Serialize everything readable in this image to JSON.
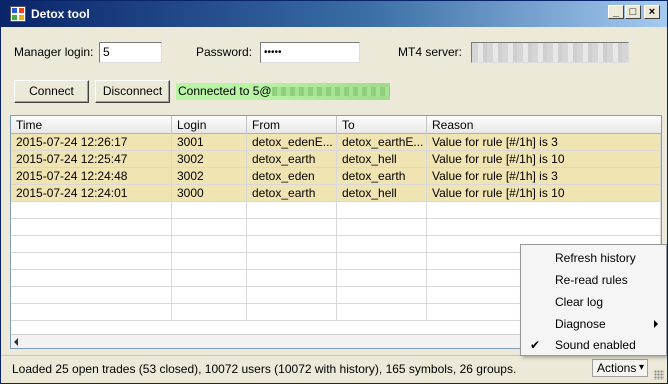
{
  "window": {
    "title": "Detox tool",
    "min_glyph": "_",
    "max_glyph": "□",
    "close_glyph": "×"
  },
  "form": {
    "manager_login_label": "Manager login:",
    "manager_login_value": "5",
    "password_label": "Password:",
    "password_value": "•••••",
    "server_label": "MT4 server:",
    "server_value": ""
  },
  "buttons": {
    "connect": "Connect",
    "disconnect": "Disconnect"
  },
  "connection_status": "Connected to 5@",
  "grid": {
    "columns": [
      "Time",
      "Login",
      "From",
      "To",
      "Reason"
    ],
    "rows": [
      [
        "2015-07-24 12:26:17",
        "3001",
        "detox_edenE...",
        "detox_earthE...",
        "Value for rule [#/1h] is 3"
      ],
      [
        "2015-07-24 12:25:47",
        "3002",
        "detox_earth",
        "detox_hell",
        "Value for rule [#/1h] is 10"
      ],
      [
        "2015-07-24 12:24:48",
        "3002",
        "detox_eden",
        "detox_earth",
        "Value for rule [#/1h] is 3"
      ],
      [
        "2015-07-24 12:24:01",
        "3000",
        "detox_earth",
        "detox_hell",
        "Value for rule [#/1h] is 10"
      ]
    ]
  },
  "status_bar": {
    "text": "Loaded 25 open trades (53 closed), 10072 users (10072 with history), 165 symbols, 26 groups.",
    "actions_label": "Actions",
    "actions_glyph": "▾"
  },
  "menu": {
    "items": [
      {
        "label": "Refresh history"
      },
      {
        "label": "Re-read rules"
      },
      {
        "label": "Clear log"
      },
      {
        "label": "Diagnose"
      },
      {
        "label": "Sound enabled",
        "check": "✔"
      }
    ]
  },
  "colors": {
    "row_highlight": "#f0e4b2",
    "connected_bg": "#b9f3a5",
    "title_gradient_start": "#0a246a"
  }
}
